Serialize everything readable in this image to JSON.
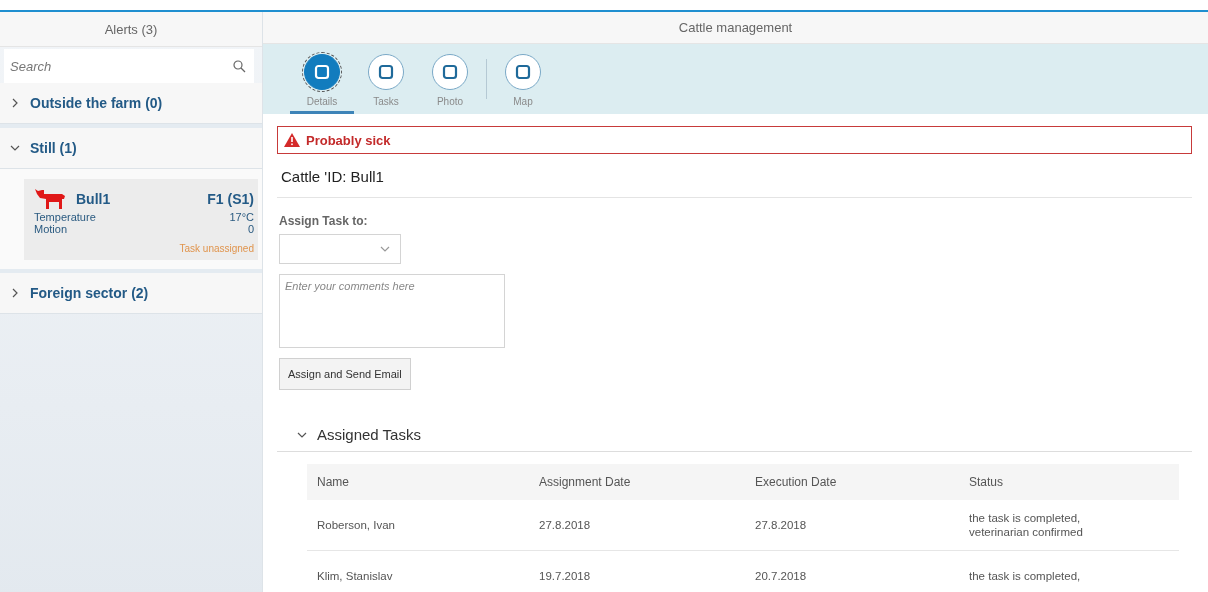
{
  "sidebar": {
    "title": "Alerts (3)",
    "search": {
      "placeholder": "Search"
    },
    "groups": [
      {
        "label": "Outside the farm",
        "count": "(0)",
        "expanded": false
      },
      {
        "label": "Still",
        "count": "(1)",
        "expanded": true,
        "items": [
          {
            "name": "Bull1",
            "location": "F1 (S1)",
            "fields": [
              {
                "label": "Temperature",
                "value": "17°C"
              },
              {
                "label": "Motion",
                "value": "0"
              }
            ],
            "task_status": "Task unassigned"
          }
        ]
      },
      {
        "label": "Foreign sector",
        "count": "(2)",
        "expanded": false
      }
    ]
  },
  "main": {
    "title": "Cattle management",
    "tabs": [
      {
        "label": "Details",
        "selected": true
      },
      {
        "label": "Tasks",
        "selected": false
      },
      {
        "label": "Photo",
        "selected": false
      },
      {
        "label": "Map",
        "selected": false
      }
    ],
    "alert": "Probably sick",
    "cattle_id": "Cattle 'ID: Bull1",
    "assign_label": "Assign Task to:",
    "comments": {
      "placeholder": "Enter your comments here"
    },
    "assign_button": "Assign and Send Email",
    "tasks": {
      "title": "Assigned Tasks",
      "expanded": true,
      "columns": [
        "Name",
        "Assignment Date",
        "Execution Date",
        "Status"
      ],
      "rows": [
        [
          "Roberson, Ivan",
          "27.8.2018",
          "27.8.2018",
          "the task is completed, veterinarian confirmed"
        ],
        [
          "Klim, Stanislav",
          "19.7.2018",
          "20.7.2018",
          "the task is completed,"
        ]
      ]
    }
  }
}
